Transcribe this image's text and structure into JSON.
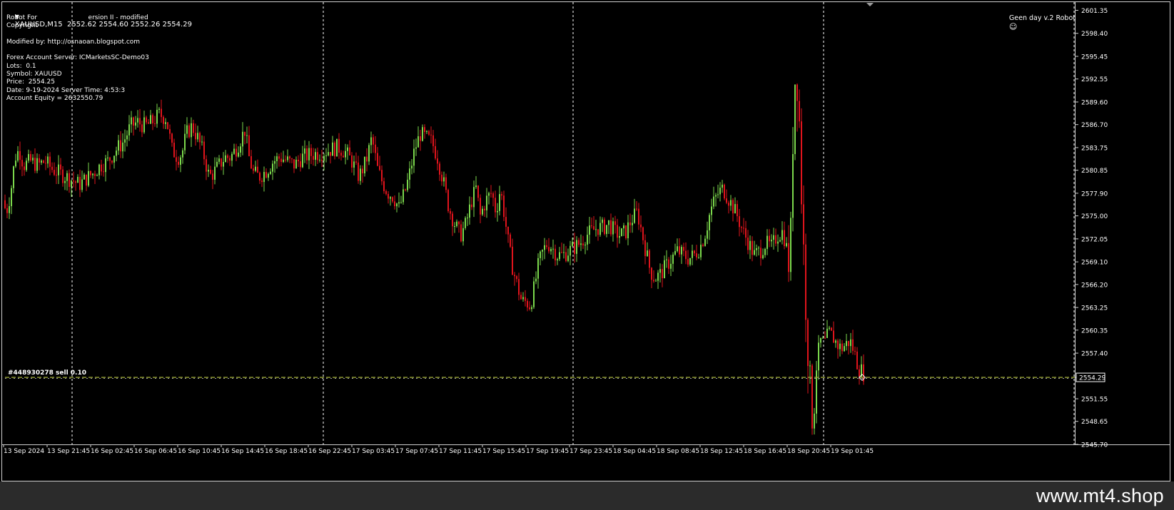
{
  "header": {
    "symbol_line": "XAUUSD,M15  2552.62 2554.60 2552.26 2554.29",
    "robot_name_right": "Geen day v.2 Robot"
  },
  "info_panel": {
    "lines": [
      "Robot For                         ersion II - modified",
      "Copyright",
      "",
      "Modified by: http://osnaoan.blogspot.com",
      "",
      "Forex Account Server: ICMarketsSC-Demo03",
      "Lots:  0.1",
      "Symbol: XAUUSD",
      "Price:  2554.25",
      "Date: 9-19-2024 Server Time: 4:53:3",
      "Account Equity = 2632550.79"
    ]
  },
  "order_line": {
    "label": "#448930278 sell 0.10",
    "price_tag": "2554.29"
  },
  "watermark": "www.mt4.shop",
  "colors": {
    "bull": "#7bd84c",
    "bear": "#e0141c",
    "order_line": "#9aa536",
    "grid": "#ffffff",
    "background": "#000000"
  },
  "chart_data": {
    "type": "candlestick",
    "symbol": "XAUUSD",
    "timeframe": "M15",
    "ylim": [
      2545.7,
      2602.4
    ],
    "y_ticks": [
      "2601.35",
      "2598.40",
      "2595.45",
      "2592.55",
      "2589.60",
      "2586.70",
      "2583.75",
      "2580.85",
      "2577.90",
      "2575.00",
      "2572.05",
      "2569.10",
      "2566.20",
      "2563.25",
      "2560.35",
      "2557.40",
      "2554.29",
      "2551.55",
      "2548.65",
      "2545.70"
    ],
    "x_ticks": [
      "13 Sep 2024",
      "13 Sep 21:45",
      "16 Sep 02:45",
      "16 Sep 06:45",
      "16 Sep 10:45",
      "16 Sep 14:45",
      "16 Sep 18:45",
      "16 Sep 22:45",
      "17 Sep 03:45",
      "17 Sep 07:45",
      "17 Sep 11:45",
      "17 Sep 15:45",
      "17 Sep 19:45",
      "17 Sep 23:45",
      "18 Sep 04:45",
      "18 Sep 08:45",
      "18 Sep 12:45",
      "18 Sep 16:45",
      "18 Sep 20:45",
      "19 Sep 01:45"
    ],
    "close_path": [
      [
        0,
        2577.0
      ],
      [
        6,
        2575.5
      ],
      [
        12,
        2578.0
      ],
      [
        18,
        2582.5
      ],
      [
        24,
        2583.5
      ],
      [
        30,
        2581.5
      ],
      [
        40,
        2582.0
      ],
      [
        50,
        2581.5
      ],
      [
        60,
        2582.0
      ],
      [
        70,
        2581.0
      ],
      [
        80,
        2580.5
      ],
      [
        90,
        2580.0
      ],
      [
        100,
        2579.5
      ],
      [
        108,
        2579.0
      ],
      [
        118,
        2579.8
      ],
      [
        128,
        2580.5
      ],
      [
        138,
        2581.5
      ],
      [
        148,
        2582.0
      ],
      [
        160,
        2583.5
      ],
      [
        170,
        2584.5
      ],
      [
        180,
        2586.5
      ],
      [
        190,
        2587.0
      ],
      [
        200,
        2586.5
      ],
      [
        210,
        2587.0
      ],
      [
        220,
        2588.0
      ],
      [
        230,
        2587.5
      ],
      [
        238,
        2583.5
      ],
      [
        246,
        2582.5
      ],
      [
        252,
        2583.0
      ],
      [
        258,
        2585.5
      ],
      [
        266,
        2586.5
      ],
      [
        274,
        2585.0
      ],
      [
        282,
        2583.0
      ],
      [
        290,
        2580.0
      ],
      [
        296,
        2580.5
      ],
      [
        304,
        2581.5
      ],
      [
        312,
        2582.5
      ],
      [
        320,
        2582.5
      ],
      [
        330,
        2584.0
      ],
      [
        340,
        2586.0
      ],
      [
        346,
        2582.5
      ],
      [
        352,
        2580.5
      ],
      [
        360,
        2580.0
      ],
      [
        370,
        2580.8
      ],
      [
        380,
        2582.0
      ],
      [
        390,
        2582.5
      ],
      [
        400,
        2582.0
      ],
      [
        410,
        2581.5
      ],
      [
        420,
        2582.5
      ],
      [
        430,
        2582.8
      ],
      [
        440,
        2583.0
      ],
      [
        450,
        2583.2
      ],
      [
        460,
        2583.5
      ],
      [
        470,
        2583.8
      ],
      [
        480,
        2583.3
      ],
      [
        490,
        2582.0
      ],
      [
        500,
        2580.0
      ],
      [
        510,
        2582.0
      ],
      [
        518,
        2585.0
      ],
      [
        526,
        2581.0
      ],
      [
        532,
        2579.5
      ],
      [
        540,
        2578.0
      ],
      [
        548,
        2577.5
      ],
      [
        556,
        2576.0
      ],
      [
        564,
        2578.0
      ],
      [
        570,
        2580.0
      ],
      [
        578,
        2583.5
      ],
      [
        586,
        2585.5
      ],
      [
        594,
        2585.0
      ],
      [
        602,
        2584.5
      ],
      [
        610,
        2582.5
      ],
      [
        618,
        2579.5
      ],
      [
        626,
        2576.0
      ],
      [
        634,
        2574.0
      ],
      [
        642,
        2572.5
      ],
      [
        650,
        2574.0
      ],
      [
        658,
        2577.0
      ],
      [
        664,
        2578.5
      ],
      [
        670,
        2575.0
      ],
      [
        678,
        2577.0
      ],
      [
        686,
        2578.0
      ],
      [
        692,
        2575.5
      ],
      [
        698,
        2578.5
      ],
      [
        704,
        2575.0
      ],
      [
        710,
        2571.0
      ],
      [
        716,
        2568.0
      ],
      [
        722,
        2566.0
      ],
      [
        728,
        2564.0
      ],
      [
        734,
        2564.0
      ],
      [
        740,
        2563.5
      ],
      [
        746,
        2566.0
      ],
      [
        752,
        2569.0
      ],
      [
        758,
        2570.5
      ],
      [
        764,
        2571.5
      ],
      [
        770,
        2571.0
      ],
      [
        778,
        2570.0
      ],
      [
        786,
        2570.0
      ],
      [
        794,
        2570.5
      ],
      [
        802,
        2571.0
      ],
      [
        810,
        2571.5
      ],
      [
        818,
        2572.5
      ],
      [
        826,
        2573.0
      ],
      [
        834,
        2573.5
      ],
      [
        842,
        2573.5
      ],
      [
        850,
        2574.0
      ],
      [
        858,
        2573.0
      ],
      [
        866,
        2572.5
      ],
      [
        874,
        2573.0
      ],
      [
        882,
        2574.5
      ],
      [
        890,
        2575.5
      ],
      [
        896,
        2573.0
      ],
      [
        902,
        2570.5
      ],
      [
        908,
        2568.0
      ],
      [
        914,
        2567.0
      ],
      [
        922,
        2567.5
      ],
      [
        930,
        2568.5
      ],
      [
        938,
        2569.5
      ],
      [
        946,
        2570.5
      ],
      [
        954,
        2570.0
      ],
      [
        962,
        2569.5
      ],
      [
        970,
        2570.0
      ],
      [
        978,
        2571.0
      ],
      [
        986,
        2573.0
      ],
      [
        992,
        2575.5
      ],
      [
        998,
        2577.0
      ],
      [
        1004,
        2578.0
      ],
      [
        1010,
        2578.5
      ],
      [
        1016,
        2577.5
      ],
      [
        1022,
        2576.5
      ],
      [
        1030,
        2575.0
      ],
      [
        1038,
        2573.0
      ],
      [
        1046,
        2571.5
      ],
      [
        1054,
        2570.0
      ],
      [
        1062,
        2570.5
      ],
      [
        1070,
        2571.5
      ],
      [
        1078,
        2571.0
      ],
      [
        1086,
        2572.5
      ],
      [
        1094,
        2573.0
      ],
      [
        1100,
        2570.5
      ],
      [
        1104,
        2568.0
      ],
      [
        1108,
        2585.0
      ],
      [
        1112,
        2595.0
      ],
      [
        1116,
        2590.0
      ],
      [
        1120,
        2578.0
      ],
      [
        1124,
        2568.0
      ],
      [
        1128,
        2560.0
      ],
      [
        1132,
        2553.0
      ],
      [
        1136,
        2548.5
      ],
      [
        1140,
        2555.0
      ],
      [
        1146,
        2559.0
      ],
      [
        1152,
        2558.5
      ],
      [
        1158,
        2560.0
      ],
      [
        1164,
        2559.5
      ],
      [
        1170,
        2558.5
      ],
      [
        1176,
        2558.0
      ],
      [
        1182,
        2558.5
      ],
      [
        1188,
        2559.0
      ],
      [
        1194,
        2557.5
      ],
      [
        1200,
        2555.5
      ],
      [
        1206,
        2555.0
      ],
      [
        1210,
        2554.29
      ]
    ]
  }
}
